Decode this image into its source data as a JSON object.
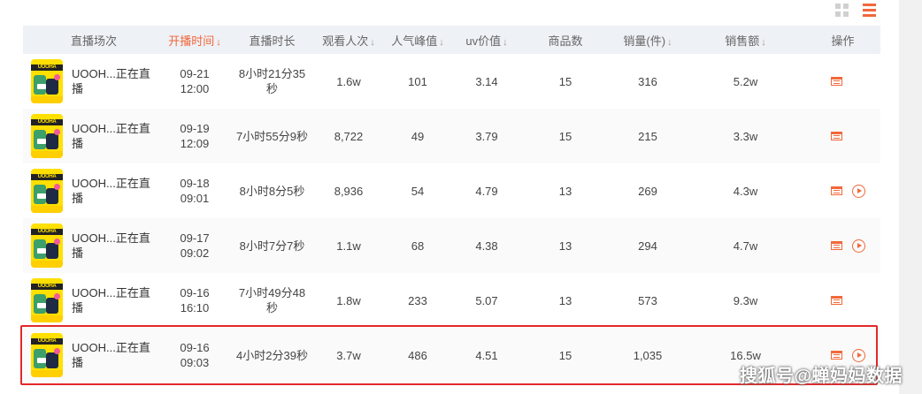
{
  "view_toggle": {
    "grid_icon": "grid-icon",
    "list_icon": "list-icon",
    "accent": "#f1683a"
  },
  "table": {
    "columns": [
      {
        "label": "直播场次",
        "sortable": false
      },
      {
        "label": "开播时间",
        "sortable": true,
        "active": true
      },
      {
        "label": "直播时长",
        "sortable": false
      },
      {
        "label": "观看人次",
        "sortable": true
      },
      {
        "label": "人气峰值",
        "sortable": true
      },
      {
        "label": "uv价值",
        "sortable": true
      },
      {
        "label": "商品数",
        "sortable": false
      },
      {
        "label": "销量(件)",
        "sortable": true
      },
      {
        "label": "销售额",
        "sortable": true
      },
      {
        "label": "操作",
        "sortable": false
      }
    ],
    "sort_arrow": "↓",
    "rows": [
      {
        "title": "UOOH...正在直播",
        "cover_brand": "UOOHA",
        "date": "09-21",
        "time": "12:00",
        "duration": "8小时21分35秒",
        "views": "1.6w",
        "peak": "101",
        "uv": "3.14",
        "products": "15",
        "sales": "316",
        "revenue": "5.2w",
        "has_play": false
      },
      {
        "title": "UOOH...正在直播",
        "cover_brand": "UOOHA",
        "date": "09-19",
        "time": "12:09",
        "duration": "7小时55分9秒",
        "views": "8,722",
        "peak": "49",
        "uv": "3.79",
        "products": "15",
        "sales": "215",
        "revenue": "3.3w",
        "has_play": false
      },
      {
        "title": "UOOH...正在直播",
        "cover_brand": "UOOHA",
        "date": "09-18",
        "time": "09:01",
        "duration": "8小时8分5秒",
        "views": "8,936",
        "peak": "54",
        "uv": "4.79",
        "products": "13",
        "sales": "269",
        "revenue": "4.3w",
        "has_play": true
      },
      {
        "title": "UOOH...正在直播",
        "cover_brand": "UOOHA",
        "date": "09-17",
        "time": "09:02",
        "duration": "8小时7分7秒",
        "views": "1.1w",
        "peak": "68",
        "uv": "4.38",
        "products": "13",
        "sales": "294",
        "revenue": "4.7w",
        "has_play": true
      },
      {
        "title": "UOOH...正在直播",
        "cover_brand": "UOOHA",
        "date": "09-16",
        "time": "16:10",
        "duration": "7小时49分48秒",
        "views": "1.8w",
        "peak": "233",
        "uv": "5.07",
        "products": "13",
        "sales": "573",
        "revenue": "9.3w",
        "has_play": false
      },
      {
        "title": "UOOH...正在直播",
        "cover_brand": "UOOHA",
        "date": "09-16",
        "time": "09:03",
        "duration": "4小时2分39秒",
        "views": "3.7w",
        "peak": "486",
        "uv": "4.51",
        "products": "15",
        "sales": "1,035",
        "revenue": "16.5w",
        "has_play": true
      }
    ]
  },
  "highlight": {
    "row_index": 5,
    "color": "#e3282a"
  },
  "watermark": "搜狐号@蝉妈妈数据"
}
